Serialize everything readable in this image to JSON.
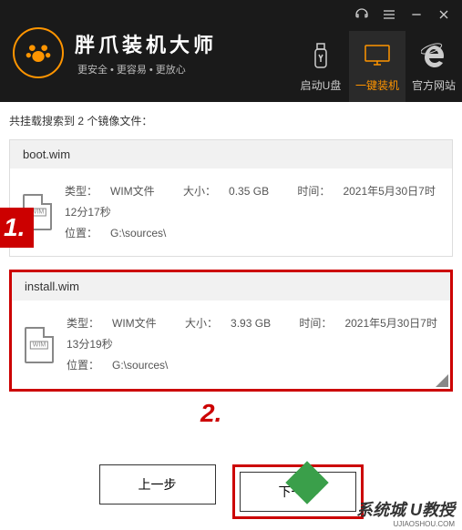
{
  "brand": {
    "title": "胖爪装机大师",
    "sub1": "更安全",
    "sub2": "更容易",
    "sub3": "更放心"
  },
  "toolbar": {
    "usb": "启动U盘",
    "install": "一键装机",
    "site": "官方网站"
  },
  "summary": {
    "prefix": "共挂载搜索到 ",
    "count": "2",
    "suffix": " 个镜像文件："
  },
  "files": [
    {
      "name": "boot.wim",
      "type_label": "类型：",
      "type_value": "WIM文件",
      "size_label": "大小：",
      "size_value": "0.35 GB",
      "time_label": "时间：",
      "time_value": "2021年5月30日7时12分17秒",
      "loc_label": "位置：",
      "loc_value": "G:\\sources\\"
    },
    {
      "name": "install.wim",
      "type_label": "类型：",
      "type_value": "WIM文件",
      "size_label": "大小：",
      "size_value": "3.93 GB",
      "time_label": "时间：",
      "time_value": "2021年5月30日7时13分19秒",
      "loc_label": "位置：",
      "loc_value": "G:\\sources\\"
    }
  ],
  "icon_badge": "WIM",
  "buttons": {
    "prev": "上一步",
    "next": "下一步"
  },
  "markers": {
    "one": "1.",
    "two": "2."
  },
  "watermark": {
    "text1": "系统城",
    "text2": "U教授",
    "url": "UJIAOSHOU.COM"
  }
}
